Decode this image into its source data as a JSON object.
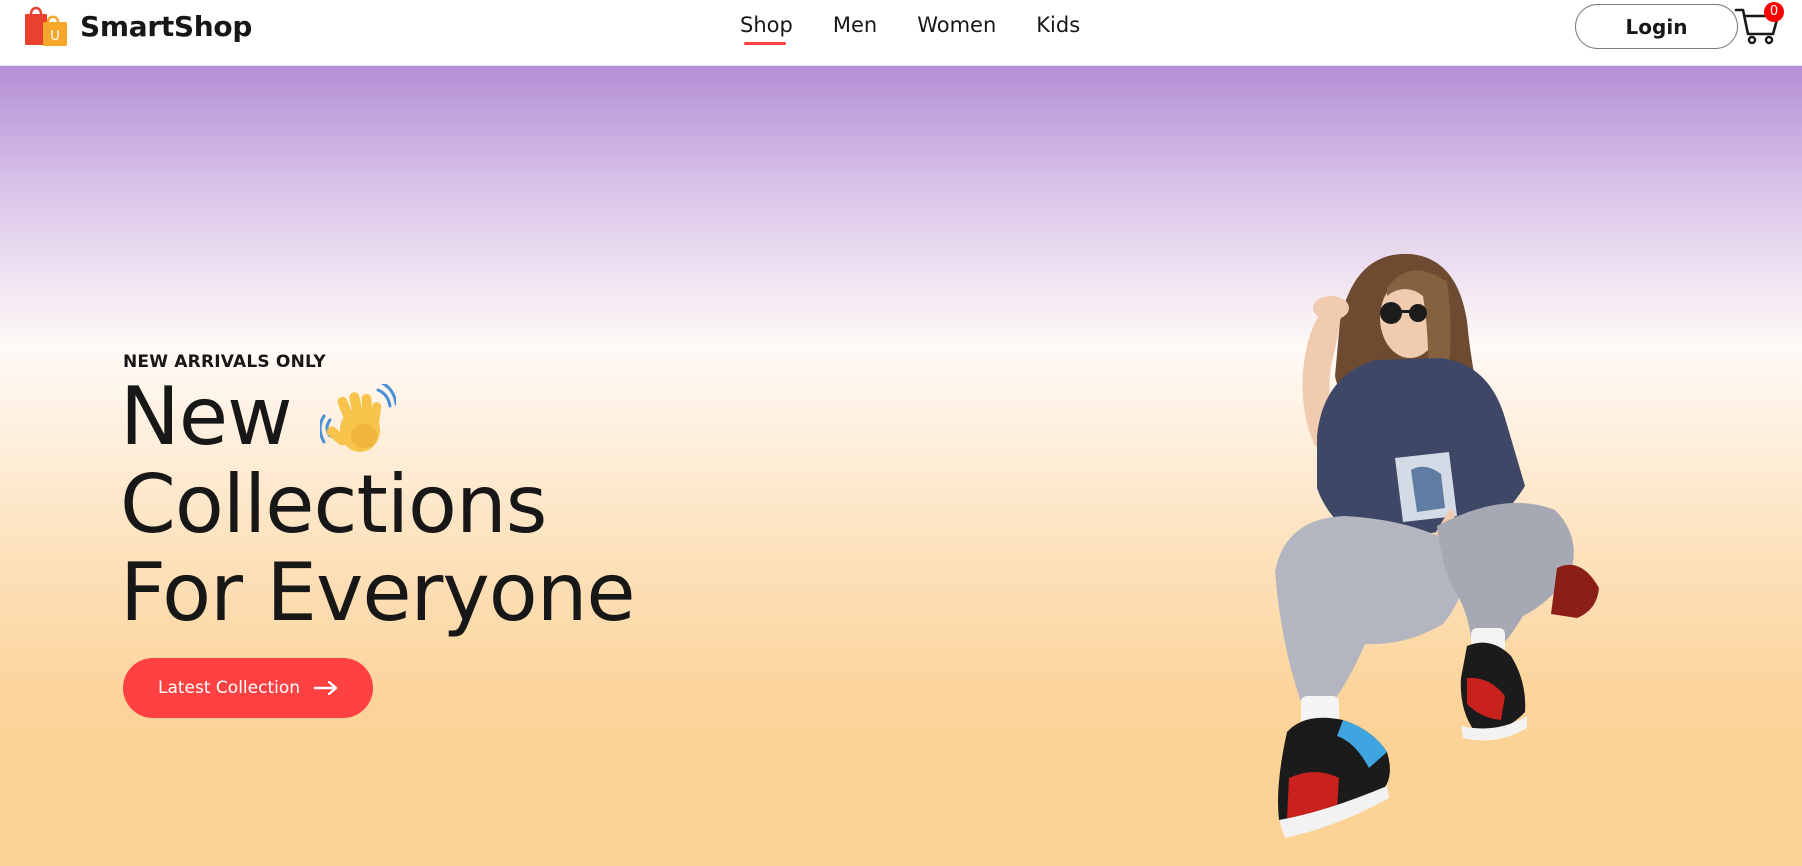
{
  "brand": {
    "name": "SmartShop",
    "logo_letter": "U",
    "logo_icon": "shopping-bags-icon"
  },
  "nav": {
    "items": [
      {
        "label": "Shop",
        "active": true
      },
      {
        "label": "Men"
      },
      {
        "label": "Women"
      },
      {
        "label": "Kids"
      }
    ]
  },
  "header": {
    "login_label": "Login",
    "cart_icon": "cart-icon",
    "cart_count": "0"
  },
  "hero": {
    "tag": "NEW ARRIVALS ONLY",
    "line1": "New",
    "line2": "Collections",
    "line3": "For Everyone",
    "emoji_icon": "waving-hand-icon",
    "cta_label": "Latest Collection",
    "cta_icon": "arrow-right-icon"
  },
  "colors": {
    "accent": "#ff4141",
    "gradient_top": "#b48fd6",
    "gradient_bottom": "#fcd394",
    "text": "#171717"
  }
}
